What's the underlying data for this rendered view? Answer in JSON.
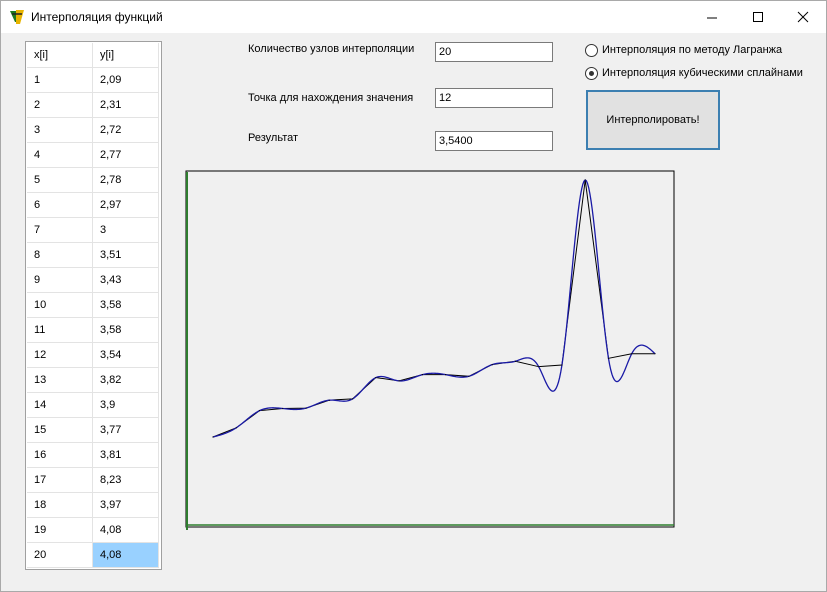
{
  "window": {
    "title": "Интерполяция функций"
  },
  "table": {
    "headers": [
      "x[i]",
      "y[i]"
    ],
    "rows": [
      [
        "1",
        "2,09"
      ],
      [
        "2",
        "2,31"
      ],
      [
        "3",
        "2,72"
      ],
      [
        "4",
        "2,77"
      ],
      [
        "5",
        "2,78"
      ],
      [
        "6",
        "2,97"
      ],
      [
        "7",
        "3"
      ],
      [
        "8",
        "3,51"
      ],
      [
        "9",
        "3,43"
      ],
      [
        "10",
        "3,58"
      ],
      [
        "11",
        "3,58"
      ],
      [
        "12",
        "3,54"
      ],
      [
        "13",
        "3,82"
      ],
      [
        "14",
        "3,9"
      ],
      [
        "15",
        "3,77"
      ],
      [
        "16",
        "3,81"
      ],
      [
        "17",
        "8,23"
      ],
      [
        "18",
        "3,97"
      ],
      [
        "19",
        "4,08"
      ],
      [
        "20",
        "4,08"
      ]
    ],
    "selected_row": 20
  },
  "form": {
    "nodes_label": "Количество узлов интерполяции",
    "nodes_value": "20",
    "point_label": "Точка для нахождения значения",
    "point_value": "12",
    "result_label": "Результат",
    "result_value": "3,5400"
  },
  "options": {
    "lagrange_label": "Интерполяция по методу Лагранжа",
    "spline_label": "Интерполяция кубическими сплайнами",
    "selected": "spline"
  },
  "button": {
    "label": "Интерполировать!"
  },
  "colors": {
    "curve": "#1a1aa6",
    "polyline": "#000000",
    "axis": "#2e7d2e",
    "selection": "#99d1ff",
    "button_border": "#3c7fb1"
  },
  "chart_data": {
    "type": "line",
    "x": [
      1,
      2,
      3,
      4,
      5,
      6,
      7,
      8,
      9,
      10,
      11,
      12,
      13,
      14,
      15,
      16,
      17,
      18,
      19,
      20
    ],
    "series": [
      {
        "values": [
          2.09,
          2.31,
          2.72,
          2.77,
          2.78,
          2.97,
          3,
          3.51,
          3.43,
          3.58,
          3.58,
          3.54,
          3.82,
          3.9,
          3.77,
          3.81,
          8.23,
          3.97,
          4.08,
          4.08
        ]
      }
    ],
    "grid": false,
    "title": "",
    "xlabel": "",
    "ylabel": ""
  }
}
